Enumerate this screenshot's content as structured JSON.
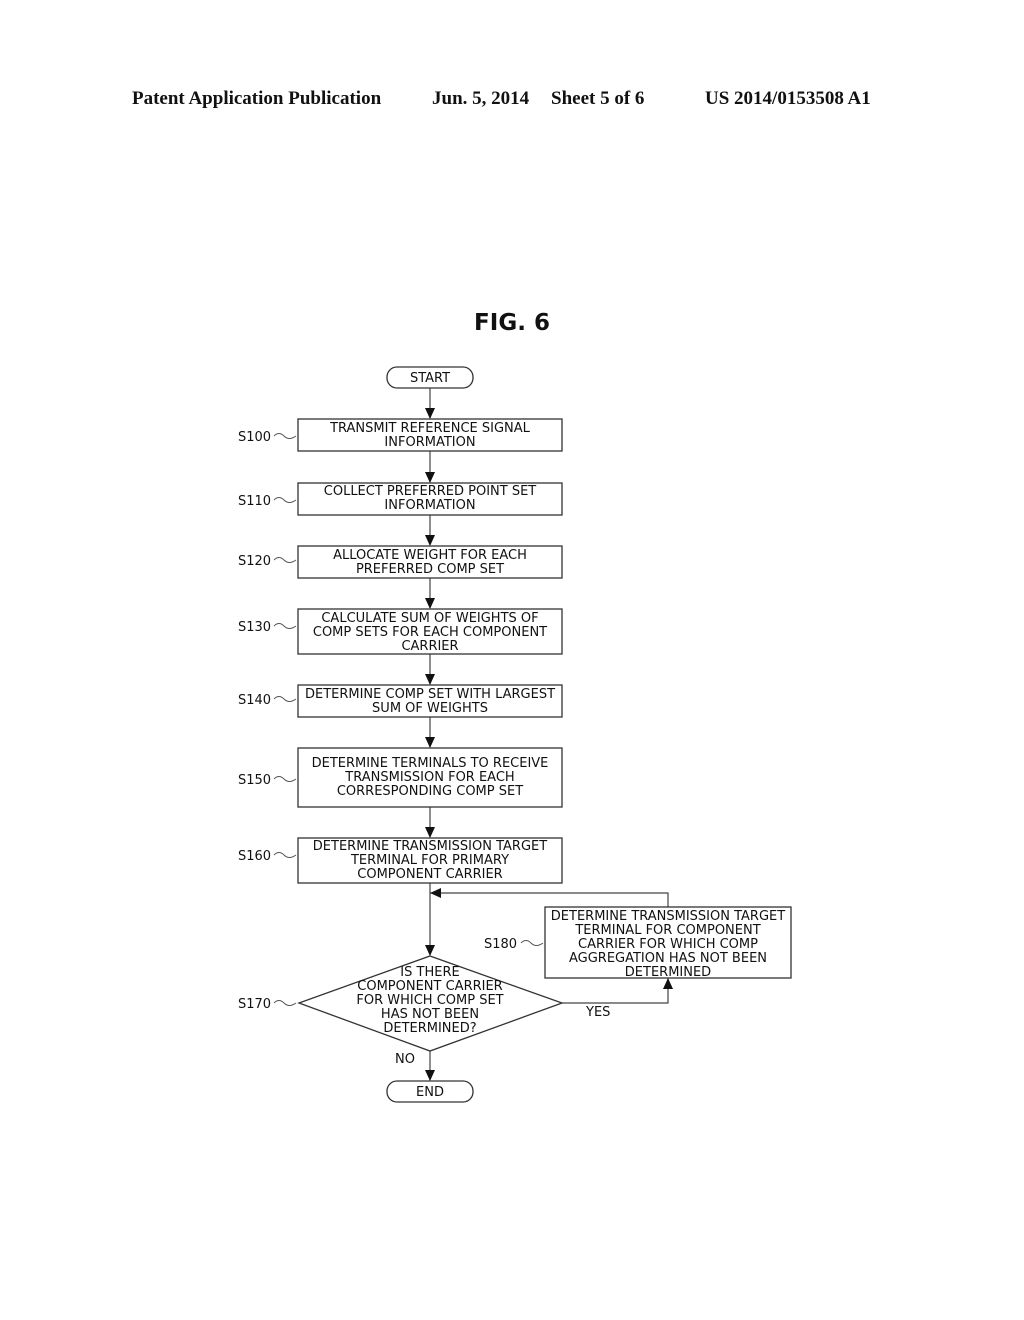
{
  "header": {
    "publication": "Patent Application Publication",
    "date": "Jun. 5, 2014",
    "sheet": "Sheet 5 of 6",
    "number": "US 2014/0153508 A1"
  },
  "figure": {
    "title": "FIG. 6"
  },
  "flowchart": {
    "start": "START",
    "end": "END",
    "steps": [
      {
        "id": "S100",
        "lines": [
          "TRANSMIT REFERENCE SIGNAL",
          "INFORMATION"
        ]
      },
      {
        "id": "S110",
        "lines": [
          "COLLECT PREFERRED POINT SET",
          "INFORMATION"
        ]
      },
      {
        "id": "S120",
        "lines": [
          "ALLOCATE WEIGHT FOR EACH",
          "PREFERRED COMP SET"
        ]
      },
      {
        "id": "S130",
        "lines": [
          "CALCULATE SUM OF WEIGHTS OF",
          "COMP SETS FOR EACH COMPONENT",
          "CARRIER"
        ]
      },
      {
        "id": "S140",
        "lines": [
          "DETERMINE COMP SET WITH LARGEST",
          "SUM OF WEIGHTS"
        ]
      },
      {
        "id": "S150",
        "lines": [
          "DETERMINE TERMINALS TO RECEIVE",
          "TRANSMISSION FOR EACH",
          "CORRESPONDING COMP SET"
        ]
      },
      {
        "id": "S160",
        "lines": [
          "DETERMINE TRANSMISSION TARGET",
          "TERMINAL FOR PRIMARY",
          "COMPONENT CARRIER"
        ]
      }
    ],
    "decision": {
      "id": "S170",
      "lines": [
        "IS THERE",
        "COMPONENT CARRIER",
        "FOR WHICH COMP SET",
        "HAS  NOT BEEN",
        "DETERMINED?"
      ],
      "yes_label": "YES",
      "no_label": "NO"
    },
    "loop_step": {
      "id": "S180",
      "lines": [
        "DETERMINE TRANSMISSION TARGET",
        "TERMINAL FOR COMPONENT",
        "CARRIER FOR WHICH COMP",
        "AGGREGATION HAS NOT BEEN",
        "DETERMINED"
      ]
    }
  }
}
